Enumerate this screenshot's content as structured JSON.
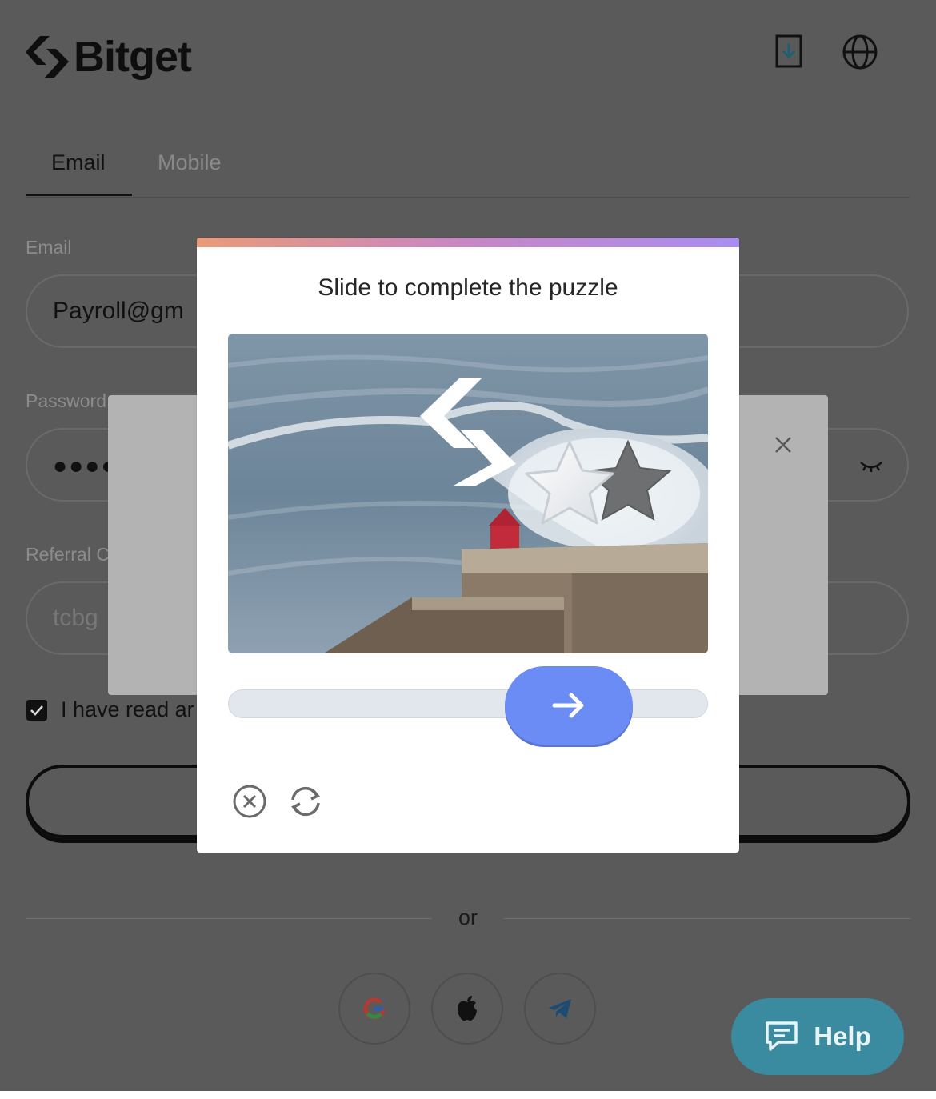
{
  "header": {
    "brand": "Bitget"
  },
  "tabs": [
    {
      "label": "Email"
    },
    {
      "label": "Mobile"
    }
  ],
  "form": {
    "email_label": "Email",
    "email_value": "Payroll@gm",
    "password_label": "Password",
    "password_value": "●●●●",
    "referral_label": "Referral C",
    "referral_placeholder": "tcbg",
    "terms_text": "I have read ar"
  },
  "or_text": "or",
  "help_label": "Help",
  "captcha": {
    "title": "Slide to complete the puzzle",
    "slider_progress": 0.66
  }
}
